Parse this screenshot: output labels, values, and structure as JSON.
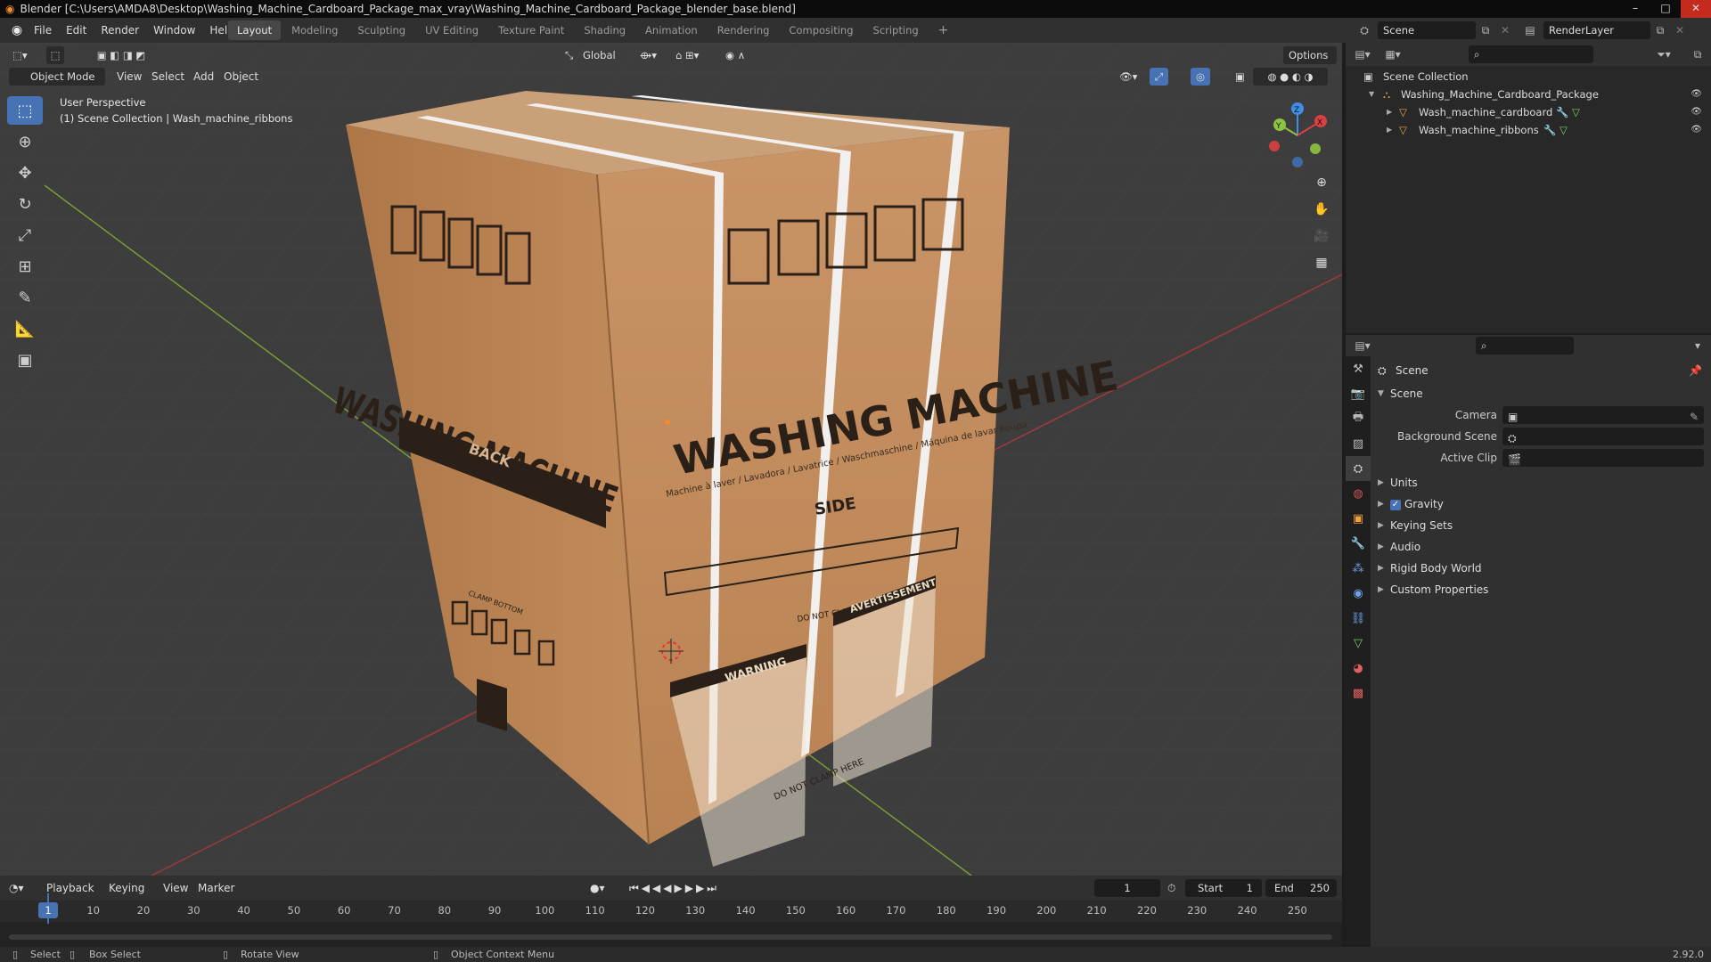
{
  "window": {
    "title": "Blender [C:\\Users\\AMDA8\\Desktop\\Washing_Machine_Cardboard_Package_max_vray\\Washing_Machine_Cardboard_Package_blender_base.blend]",
    "minimize": "–",
    "maximize": "□",
    "close": "✕"
  },
  "menu": [
    "File",
    "Edit",
    "Render",
    "Window",
    "Help"
  ],
  "workspaces": [
    {
      "label": "Layout",
      "active": true
    },
    {
      "label": "Modeling",
      "active": false
    },
    {
      "label": "Sculpting",
      "active": false
    },
    {
      "label": "UV Editing",
      "active": false
    },
    {
      "label": "Texture Paint",
      "active": false
    },
    {
      "label": "Shading",
      "active": false
    },
    {
      "label": "Animation",
      "active": false
    },
    {
      "label": "Rendering",
      "active": false
    },
    {
      "label": "Compositing",
      "active": false
    },
    {
      "label": "Scripting",
      "active": false
    }
  ],
  "add_workspace": "+",
  "scene_field": "Scene",
  "render_layer_field": "RenderLayer",
  "viewport": {
    "transform_orientation": "Global",
    "options_label": "Options",
    "mode": "Object Mode",
    "menus": [
      "View",
      "Select",
      "Add",
      "Object"
    ],
    "info_line1": "User Perspective",
    "info_line2": "(1) Scene Collection | Wash_machine_ribbons",
    "gizmo_axes": {
      "x": "X",
      "y": "Y",
      "z": "Z"
    }
  },
  "box_art": {
    "front_title": "WASHING MACHINE",
    "front_sub": "Machine à laver / Lavadora / Lavatrice / Waschmaschine / Máquina de lavar Roupa",
    "front_side": "SIDE",
    "front_clamp": "DO NOT CLAMP",
    "front_warning": "WARNING",
    "front_avert": "AVERTISSEMENT",
    "front_bottom": "DO NOT CLAMP HERE",
    "left_title": "WASHING MACHINE",
    "left_back": "BACK",
    "left_clamp": "CLAMP BOTTOM"
  },
  "timeline": {
    "menus": [
      "Playback",
      "Keying",
      "View",
      "Marker"
    ],
    "current_frame": "1",
    "start_label": "Start",
    "start_value": "1",
    "end_label": "End",
    "end_value": "250",
    "ticks": [
      "10",
      "20",
      "30",
      "40",
      "50",
      "60",
      "70",
      "80",
      "90",
      "100",
      "110",
      "120",
      "130",
      "140",
      "150",
      "160",
      "170",
      "180",
      "190",
      "200",
      "210",
      "220",
      "230",
      "240",
      "250"
    ],
    "playhead_label": "1"
  },
  "status_bar": {
    "select": "Select",
    "box_select": "Box Select",
    "rotate_view": "Rotate View",
    "context_menu": "Object Context Menu",
    "version": "2.92.0"
  },
  "outliner": {
    "root": "Scene Collection",
    "collection": "Washing_Machine_Cardboard_Package",
    "objects": [
      "Wash_machine_cardboard",
      "Wash_machine_ribbons"
    ]
  },
  "properties": {
    "context": "Scene",
    "panel": "Scene",
    "fields": [
      {
        "label": "Camera"
      },
      {
        "label": "Background Scene"
      },
      {
        "label": "Active Clip"
      }
    ],
    "subpanels": [
      "Units",
      "Gravity",
      "Keying Sets",
      "Audio",
      "Rigid Body World",
      "Custom Properties"
    ],
    "gravity_checked": true
  },
  "colors": {
    "accent": "#4772b3",
    "viewport_bg": "#3d3d3d",
    "cardboard": "#c89466",
    "x_axis": "#db4040",
    "y_axis": "#8fc33e",
    "z_axis": "#3f8ee6"
  },
  "icons": {
    "check": "✓",
    "eye": "👁",
    "expand": "▶",
    "collapse": "▼"
  }
}
